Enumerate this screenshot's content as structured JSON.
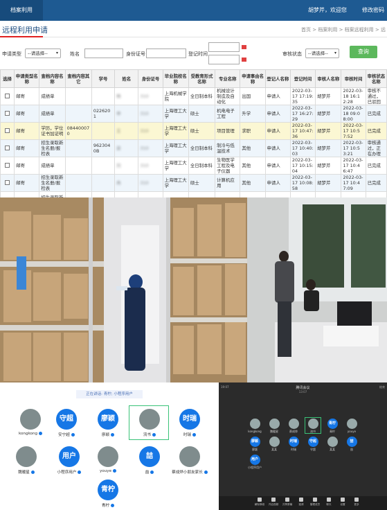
{
  "app": {
    "title": "档案利用",
    "welcome": "胡梦芹，欢迎您",
    "logout": "修改密码"
  },
  "page": {
    "title": "远程利用申请",
    "breadcrumb": "首页 > 档案利用 > 档案远程利用 > 远"
  },
  "search": {
    "type_label": "申请类型",
    "type_value": "--请选择--",
    "name_label": "姓名",
    "idcard_label": "身份证号",
    "reg_time_label": "登记时间",
    "status_label": "审核状态",
    "status_value": "--请选择--",
    "query_button": "查询"
  },
  "table": {
    "columns": [
      "选择",
      "申请类型名称",
      "查档内容名称",
      "查档内容其它",
      "学号",
      "姓名",
      "身份证号",
      "毕业院校名称",
      "受教育形式名称",
      "专业名称",
      "申请事由名称",
      "登记人名称",
      "登记时间",
      "审核人名称",
      "审核时间",
      "审核状态名称"
    ],
    "rows": [
      {
        "type": "邮寄",
        "content": "成绩单",
        "other": "",
        "sid": "",
        "name": "韩",
        "idno": "310",
        "school": "上海机械学院",
        "edu": "全日制本科",
        "major": "机械设计制造及自动化",
        "reason": "出国",
        "registrar": "申请人",
        "regtime": "2022-03-17 17:19:35",
        "reviewer": "胡梦芹",
        "revtime": "2022-03-18 16:12:28",
        "status": "审核不通过，已驳回"
      },
      {
        "type": "邮寄",
        "content": "成绩单",
        "other": "",
        "sid": "0226201",
        "name": "申",
        "idno": "310",
        "school": "上海理工大学",
        "edu": "硕士",
        "major": "机电电子工程",
        "reason": "升学",
        "registrar": "申请人",
        "regtime": "2022-03-17 16:27:29",
        "reviewer": "胡梦芹",
        "revtime": "2022-03-18 09:08:00",
        "status": "已完成"
      },
      {
        "type": "邮寄",
        "content": "学历，学位证书加证明",
        "other": "084400070",
        "sid": "",
        "name": "王",
        "idno": "310",
        "school": "上海理工大学",
        "edu": "硕士",
        "major": "项目管理",
        "reason": "求职",
        "registrar": "申请人",
        "regtime": "2022-03-17 10:47:36",
        "reviewer": "胡梦芹",
        "revtime": "2022-03-17 10:57:52",
        "status": "已完成"
      },
      {
        "type": "邮寄",
        "content": "招生录取新生名册/报检表",
        "other": "",
        "sid": "9623040B",
        "name": "梁",
        "idno": "310",
        "school": "上海理工大学",
        "edu": "全日制本科",
        "major": "制冷与低温技术",
        "reason": "其他",
        "registrar": "申请人",
        "regtime": "2022-03-17 10:40:03",
        "reviewer": "胡梦芹",
        "revtime": "2022-03-17 10:53:21",
        "status": "审核通过，正在办理"
      },
      {
        "type": "邮寄",
        "content": "成绩单",
        "other": "",
        "sid": "",
        "name": "刘",
        "idno": "310",
        "school": "上海理工大学",
        "edu": "全日制本科",
        "major": "生物医学工程及电子仪器",
        "reason": "其他",
        "registrar": "申请人",
        "regtime": "2022-03-17 10:15:04",
        "reviewer": "胡梦芹",
        "revtime": "2022-03-17 10:46:47",
        "status": "已完成"
      },
      {
        "type": "邮寄",
        "content": "招生录取新生名册/报检表",
        "other": "",
        "sid": "",
        "name": "冉",
        "idno": "310",
        "school": "上海理工大学",
        "edu": "硕士",
        "major": "计算机应用",
        "reason": "其他",
        "registrar": "申请人",
        "regtime": "2022-03-17 10:08:58",
        "reviewer": "胡梦芹",
        "revtime": "2022-03-17 10:47:09",
        "status": "已完成"
      },
      {
        "type": "",
        "content": "招生录取新生名册/报",
        "other": "",
        "sid": "",
        "name": "",
        "idno": "",
        "school": "",
        "edu": "",
        "major": "",
        "reason": "",
        "registrar": "",
        "regtime": "",
        "reviewer": "",
        "revtime": "",
        "status": ""
      }
    ]
  },
  "meeting_left": {
    "speaking": "正在讲话: 青柠; 小程序用户",
    "participants": [
      {
        "name": "kongkong",
        "avatar": "",
        "type": "photo"
      },
      {
        "name": "安宁超",
        "avatar": "守超",
        "type": "blue"
      },
      {
        "name": "廖颖",
        "avatar": "廖颖",
        "type": "blue"
      },
      {
        "name": "流书",
        "avatar": "",
        "type": "photo"
      },
      {
        "name": "时瑞",
        "avatar": "时瑞",
        "type": "blue"
      },
      {
        "name": "魏暖星",
        "avatar": "",
        "type": "photo"
      },
      {
        "name": "小程序用户",
        "avatar": "用户",
        "type": "blue"
      },
      {
        "name": "youye",
        "avatar": "",
        "type": "photo"
      },
      {
        "name": "喆",
        "avatar": "喆",
        "type": "blue"
      },
      {
        "name": "蔡成烨小朋友家长",
        "avatar": "",
        "type": "photo"
      },
      {
        "name": "青柠",
        "avatar": "青柠",
        "type": "blue"
      }
    ]
  },
  "meeting_right": {
    "title": "腾讯会议",
    "time": "13:07",
    "top_left": "19:07",
    "top_right": "结束",
    "row1": [
      {
        "name": "kongkong",
        "avatar": "",
        "type": "ph"
      },
      {
        "name": "魏暖星",
        "avatar": "",
        "type": "ph"
      },
      {
        "name": "蔡成烨",
        "avatar": "",
        "type": "ph"
      },
      {
        "name": "流书",
        "avatar": "",
        "type": "ph"
      },
      {
        "name": "青柠",
        "avatar": "青柠",
        "type": "blue"
      },
      {
        "name": "youye",
        "avatar": "",
        "type": "ph"
      }
    ],
    "row2": [
      {
        "name": "廖颖",
        "avatar": "廖颖",
        "type": "blue"
      },
      {
        "name": "某某",
        "avatar": "",
        "type": "ph"
      },
      {
        "name": "时瑞",
        "avatar": "时瑞",
        "type": "blue"
      },
      {
        "name": "守超",
        "avatar": "守超",
        "type": "blue"
      },
      {
        "name": "某某",
        "avatar": "",
        "type": "ph"
      },
      {
        "name": "喆",
        "avatar": "喆",
        "type": "blue"
      }
    ],
    "row3": [
      {
        "name": "小程序用户",
        "avatar": "用户",
        "type": "blue"
      }
    ],
    "toolbar": [
      "解除静音",
      "开启视频",
      "共享屏幕",
      "邀请",
      "管理成员",
      "聊天",
      "设置",
      "更多"
    ]
  }
}
